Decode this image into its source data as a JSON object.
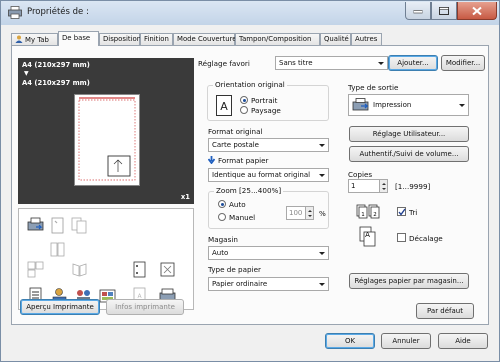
{
  "window": {
    "title": "Propriétés de :"
  },
  "tabs": [
    {
      "label": "My Tab"
    },
    {
      "label": "De base"
    },
    {
      "label": "Disposition"
    },
    {
      "label": "Finition"
    },
    {
      "label": "Mode Couverture"
    },
    {
      "label": "Tampon/Composition"
    },
    {
      "label": "Qualité"
    },
    {
      "label": "Autres"
    }
  ],
  "preview": {
    "paper_line1": "A4 (210x297 mm)",
    "arrow": "▼",
    "paper_line2": "A4 (210x297 mm)",
    "copies_badge": "x1"
  },
  "left_buttons": {
    "apercu": "Aperçu Imprimante",
    "infos": "Infos imprimante"
  },
  "favori": {
    "label": "Réglage favori",
    "value": "Sans titre",
    "ajouter": "Ajouter...",
    "modifier": "Modifier..."
  },
  "orientation": {
    "legend": "Orientation original",
    "portrait": "Portrait",
    "paysage": "Paysage"
  },
  "format_original": {
    "label": "Format original",
    "value": "Carte postale"
  },
  "format_papier": {
    "label": "Format papier",
    "value": "Identique au format original"
  },
  "zoom": {
    "legend": "Zoom [25...400%]",
    "auto": "Auto",
    "manuel": "Manuel",
    "value": "100",
    "unit": "%"
  },
  "magasin": {
    "label": "Magasin",
    "value": "Auto"
  },
  "type_papier": {
    "label": "Type de papier",
    "value": "Papier ordinaire"
  },
  "type_sortie": {
    "label": "Type de sortie",
    "value": "Impression"
  },
  "right_buttons": {
    "reglage_utilisateur": "Réglage Utilisateur...",
    "authentif": "Authentif./Suivi de volume...",
    "reglages_papier": "Réglages papier par magasin...",
    "par_defaut": "Par défaut"
  },
  "copies": {
    "label": "Copies",
    "value": "1",
    "range": "[1...9999]",
    "tri": "Tri",
    "decalage": "Décalage"
  },
  "footer": {
    "ok": "OK",
    "annuler": "Annuler",
    "aide": "Aide"
  },
  "colors": {
    "accent_blue": "#1f5fbf",
    "preview_bg": "#3a3a3a",
    "close_red": "#c75a44"
  }
}
